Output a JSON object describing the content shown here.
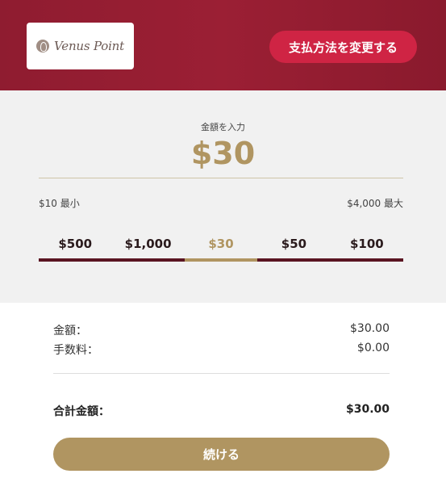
{
  "header": {
    "logo_text": "Venus Point",
    "change_method_label": "支払方法を変更する"
  },
  "amount": {
    "label": "金額を入力",
    "value": "$30",
    "min_label": "$10 最小",
    "max_label": "$4,000 最大",
    "presets": [
      "$500",
      "$1,000",
      "$30",
      "$50",
      "$100"
    ],
    "selected_preset": "$30"
  },
  "summary": {
    "amount_label": "金額：",
    "amount_value": "$30.00",
    "fee_label": "手数料：",
    "fee_value": "$0.00",
    "total_label": "合計金額：",
    "total_value": "$30.00"
  },
  "continue_label": "続ける",
  "colors": {
    "header_bg": "#9b1f34",
    "accent_red": "#cf2444",
    "gold": "#b09561",
    "dark_maroon": "#5a1522"
  }
}
